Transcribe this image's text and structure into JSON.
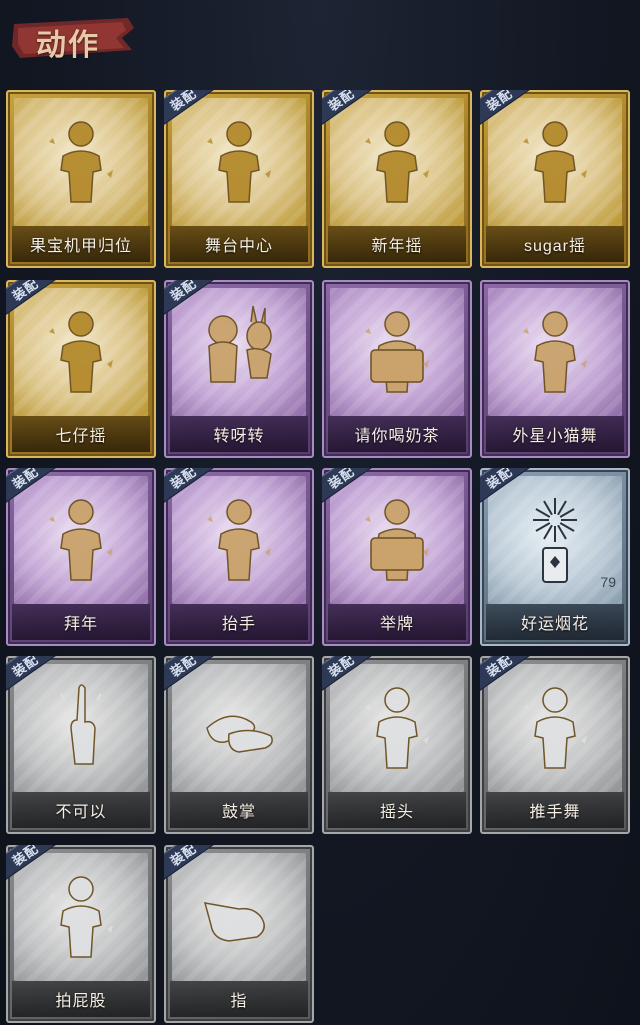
{
  "header": {
    "title": "动作"
  },
  "equip_tag_label": "装配",
  "colors": {
    "gold": "#c9a43b",
    "purple": "#8e6ba8",
    "blue": "#8aa0b6",
    "gray": "#8d8f92",
    "background": "#141a26",
    "title": "#e8c9a8"
  },
  "cards": [
    {
      "label": "果宝机甲归位",
      "rarity": "gold",
      "equipped": false,
      "icon": "figure-dance-icon"
    },
    {
      "label": "舞台中心",
      "rarity": "gold",
      "equipped": true,
      "icon": "figure-sing-icon"
    },
    {
      "label": "新年摇",
      "rarity": "gold",
      "equipped": true,
      "icon": "figure-sway-icon"
    },
    {
      "label": "sugar摇",
      "rarity": "gold",
      "equipped": true,
      "icon": "figure-groove-icon"
    },
    {
      "label": "七仔摇",
      "rarity": "gold",
      "equipped": true,
      "icon": "figure-shake-icon"
    },
    {
      "label": "转呀转",
      "rarity": "purple",
      "equipped": true,
      "icon": "girl-with-rabbit-icon"
    },
    {
      "label": "请你喝奶茶",
      "rarity": "purple",
      "equipped": false,
      "icon": "figure-holding-sign-icon"
    },
    {
      "label": "外星小猫舞",
      "rarity": "purple",
      "equipped": false,
      "icon": "figure-pose-icon"
    },
    {
      "label": "拜年",
      "rarity": "purple",
      "equipped": true,
      "icon": "figure-greeting-icon"
    },
    {
      "label": "抬手",
      "rarity": "purple",
      "equipped": true,
      "icon": "figure-raise-hand-icon"
    },
    {
      "label": "举牌",
      "rarity": "purple",
      "equipped": true,
      "icon": "figure-hold-board-icon"
    },
    {
      "label": "好运烟花",
      "rarity": "blue",
      "equipped": true,
      "icon": "firework-icon",
      "count": "79"
    },
    {
      "label": "不可以",
      "rarity": "gray",
      "equipped": true,
      "icon": "finger-wag-icon"
    },
    {
      "label": "鼓掌",
      "rarity": "gray",
      "equipped": true,
      "icon": "clapping-hands-icon"
    },
    {
      "label": "摇头",
      "rarity": "gray",
      "equipped": true,
      "icon": "figure-head-shake-icon"
    },
    {
      "label": "推手舞",
      "rarity": "gray",
      "equipped": true,
      "icon": "figure-push-dance-icon"
    },
    {
      "label": "拍屁股",
      "rarity": "gray",
      "equipped": true,
      "icon": "figure-pat-icon"
    },
    {
      "label": "指",
      "rarity": "gray",
      "equipped": true,
      "icon": "pointing-hand-icon"
    }
  ]
}
